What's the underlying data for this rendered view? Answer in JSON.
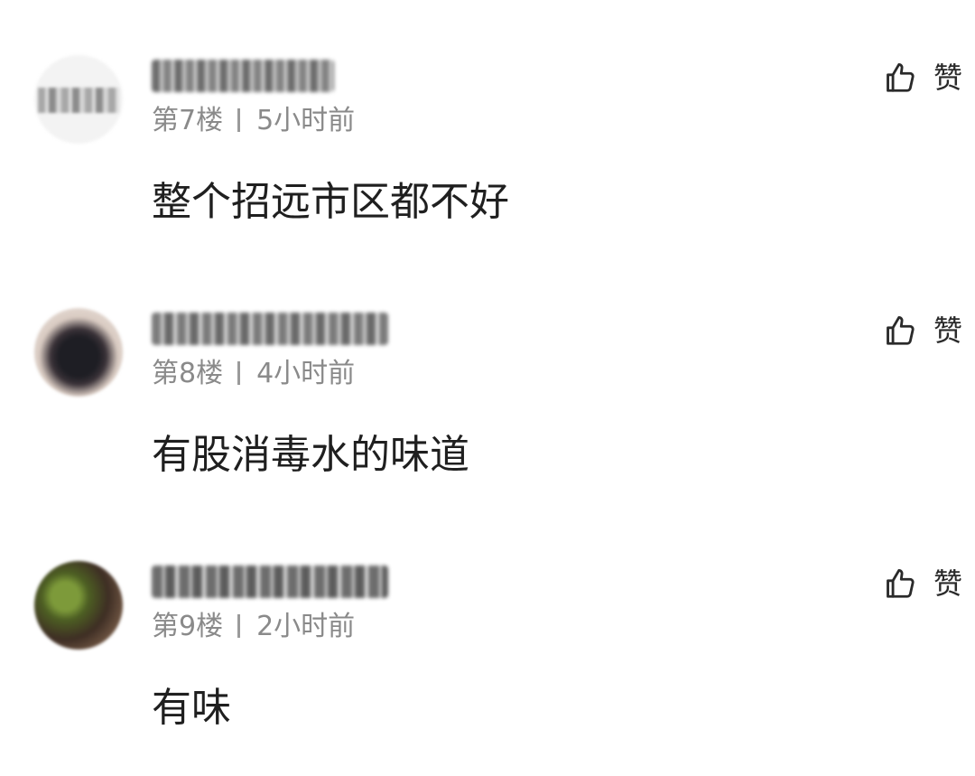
{
  "comments": [
    {
      "floor": "第7楼",
      "time": "5小时前",
      "content": "整个招远市区都不好",
      "like_label": "赞"
    },
    {
      "floor": "第8楼",
      "time": "4小时前",
      "content": "有股消毒水的味道",
      "like_label": "赞"
    },
    {
      "floor": "第9楼",
      "time": "2小时前",
      "content": "有味",
      "like_label": "赞"
    }
  ],
  "icons": {
    "like": "thumbs-up-icon"
  },
  "colors": {
    "meta_text": "#8a8a8a",
    "content_text": "#1f1f1f",
    "icon": "#2a2a2a"
  }
}
